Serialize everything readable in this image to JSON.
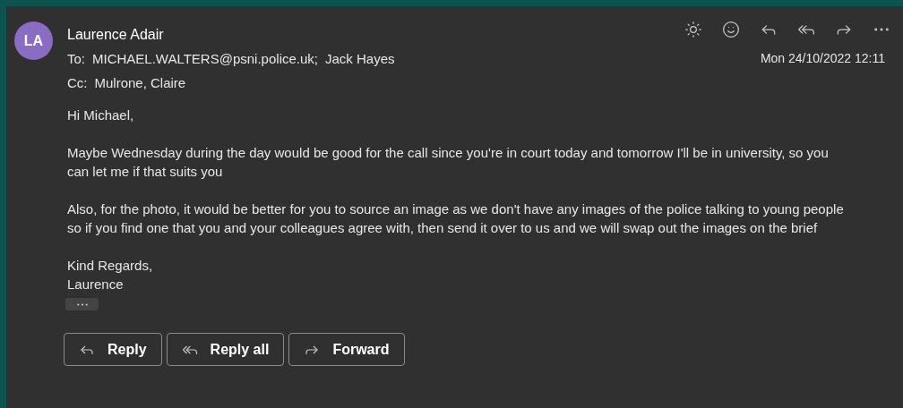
{
  "message": {
    "avatar_initials": "LA",
    "sender": "Laurence Adair",
    "to_label": "To:",
    "recipients": [
      "MICHAEL.WALTERS@psni.police.uk;",
      "Jack Hayes"
    ],
    "cc_label": "Cc:",
    "cc": [
      "Mulrone, Claire"
    ],
    "date": "Mon 24/10/2022 12:11",
    "body": [
      "Hi Michael,",
      "Maybe Wednesday during the day would be good for the call since you're in court today and tomorrow I'll be in university, so you can let me if that suits you",
      "Also, for the photo, it would be better for you to source an image as we don't have any images of the police talking to young people so if you find one that you and your colleagues agree with, then send it over to us and we will swap out the images on the brief"
    ],
    "signoff": [
      "Kind Regards,",
      "Laurence"
    ]
  },
  "toolbar": [
    {
      "kind": "brightness"
    },
    {
      "kind": "emoji"
    },
    {
      "kind": "reply"
    },
    {
      "kind": "reply_all"
    },
    {
      "kind": "forward"
    },
    {
      "kind": "more"
    }
  ],
  "actions": [
    {
      "kind": "reply",
      "label": "Reply"
    },
    {
      "kind": "reply_all",
      "label": "Reply all"
    },
    {
      "kind": "forward",
      "label": "Forward"
    }
  ]
}
